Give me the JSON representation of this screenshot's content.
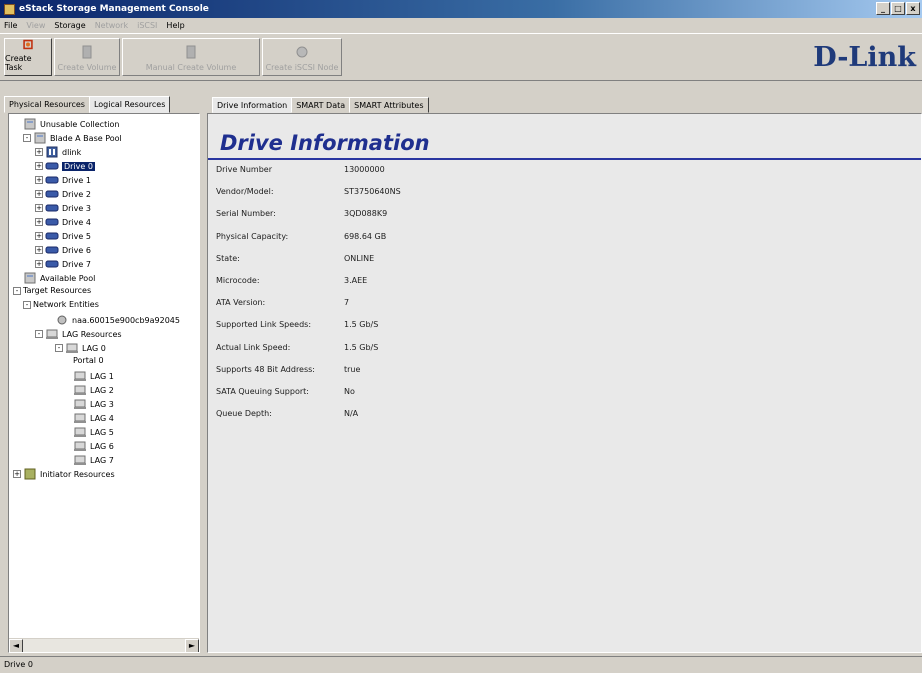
{
  "window": {
    "title": "eStack Storage Management Console"
  },
  "menu": [
    "File",
    "View",
    "Storage",
    "Network",
    "iSCSI",
    "Help"
  ],
  "toolbar": {
    "create_task": "Create Task",
    "create_volume": "Create Volume",
    "manual_create_volume": "Manual Create Volume",
    "create_iscsi": "Create iSCSI Node",
    "logo": "D-Link"
  },
  "left_tabs": [
    "Physical Resources",
    "Logical Resources"
  ],
  "tree": [
    {
      "label": "Unusable Collection",
      "depth": 1,
      "icon": "collection-icon",
      "expander": ""
    },
    {
      "label": "Blade A Base Pool",
      "depth": 1,
      "icon": "pool-icon",
      "expander": "-"
    },
    {
      "label": "dlink",
      "depth": 2,
      "icon": "blade-icon",
      "expander": "+"
    },
    {
      "label": "Drive 0",
      "depth": 2,
      "icon": "drive-icon",
      "expander": "+",
      "selected": true
    },
    {
      "label": "Drive 1",
      "depth": 2,
      "icon": "drive-icon",
      "expander": "+"
    },
    {
      "label": "Drive 2",
      "depth": 2,
      "icon": "drive-icon",
      "expander": "+"
    },
    {
      "label": "Drive 3",
      "depth": 2,
      "icon": "drive-icon",
      "expander": "+"
    },
    {
      "label": "Drive 4",
      "depth": 2,
      "icon": "drive-icon",
      "expander": "+"
    },
    {
      "label": "Drive 5",
      "depth": 2,
      "icon": "drive-icon",
      "expander": "+"
    },
    {
      "label": "Drive 6",
      "depth": 2,
      "icon": "drive-icon",
      "expander": "+"
    },
    {
      "label": "Drive 7",
      "depth": 2,
      "icon": "drive-icon",
      "expander": "+"
    },
    {
      "label": "Available Pool",
      "depth": 1,
      "icon": "pool-icon",
      "expander": ""
    },
    {
      "label": "Target Resources",
      "depth": 0,
      "icon": "",
      "expander": "-"
    },
    {
      "label": "Network Entities",
      "depth": 1,
      "icon": "",
      "expander": "-"
    },
    {
      "label": "naa.60015e900cb9a92045",
      "depth": 3,
      "icon": "network-icon",
      "expander": ""
    },
    {
      "label": "LAG Resources",
      "depth": 2,
      "icon": "lag-icon",
      "expander": "-"
    },
    {
      "label": "LAG 0",
      "depth": 3,
      "icon": "lag-icon",
      "expander": "-"
    },
    {
      "label": "Portal 0",
      "depth": 4,
      "icon": "",
      "expander": ""
    },
    {
      "label": "LAG 1",
      "depth": 4,
      "icon": "lag-icon",
      "expander": ""
    },
    {
      "label": "LAG 2",
      "depth": 4,
      "icon": "lag-icon",
      "expander": ""
    },
    {
      "label": "LAG 3",
      "depth": 4,
      "icon": "lag-icon",
      "expander": ""
    },
    {
      "label": "LAG 4",
      "depth": 4,
      "icon": "lag-icon",
      "expander": ""
    },
    {
      "label": "LAG 5",
      "depth": 4,
      "icon": "lag-icon",
      "expander": ""
    },
    {
      "label": "LAG 6",
      "depth": 4,
      "icon": "lag-icon",
      "expander": ""
    },
    {
      "label": "LAG 7",
      "depth": 4,
      "icon": "lag-icon",
      "expander": ""
    },
    {
      "label": "Initiator Resources",
      "depth": 0,
      "icon": "initiator-icon",
      "expander": "+"
    }
  ],
  "right_tabs": [
    "Drive Information",
    "SMART Data",
    "SMART Attributes"
  ],
  "drive_info": {
    "heading": "Drive Information",
    "rows": [
      {
        "label": "Drive Number",
        "value": "13000000"
      },
      {
        "label": "Vendor/Model:",
        "value": "ST3750640NS"
      },
      {
        "label": "Serial Number:",
        "value": "3QD088K9"
      },
      {
        "label": "Physical Capacity:",
        "value": "698.64 GB"
      },
      {
        "label": "State:",
        "value": "ONLINE"
      },
      {
        "label": "Microcode:",
        "value": "3.AEE"
      },
      {
        "label": "ATA Version:",
        "value": "7"
      },
      {
        "label": "Supported Link Speeds:",
        "value": "1.5 Gb/S"
      },
      {
        "label": "Actual Link Speed:",
        "value": "1.5 Gb/S"
      },
      {
        "label": "Supports 48 Bit Address:",
        "value": "true"
      },
      {
        "label": "SATA Queuing Support:",
        "value": "No"
      },
      {
        "label": "Queue Depth:",
        "value": "N/A"
      }
    ]
  },
  "status": {
    "text": "Drive 0"
  },
  "colors": {
    "title_bar": "#0a246a",
    "heading": "#1f2f8f",
    "logo": "#1f3a7a",
    "selection": "#0a246a"
  }
}
